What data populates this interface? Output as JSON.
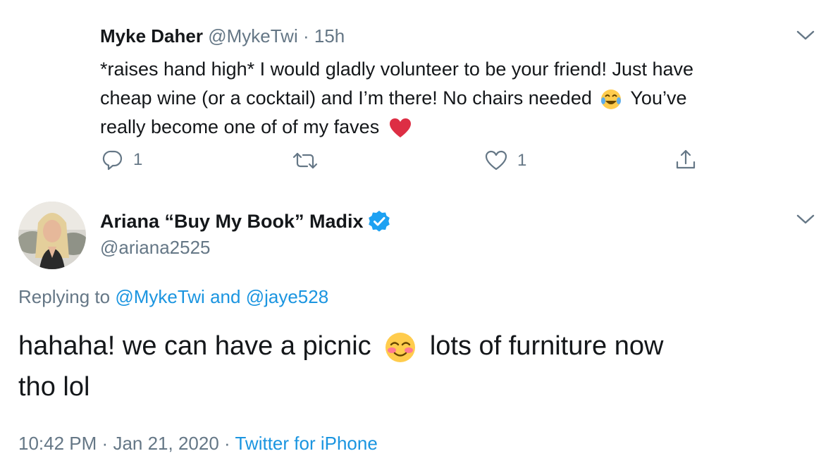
{
  "reply_tweet": {
    "author_name": "Myke Daher",
    "handle": "@MykeTwi",
    "time_sep": "·",
    "time": "15h",
    "text_line1": "*raises hand high* I would gladly volunteer to be your friend! Just have",
    "text_line2a": "cheap wine (or a cocktail) and I’m there! No chairs needed",
    "text_line2b": "You’ve",
    "text_line3": "really become one of of my faves",
    "emoji_laugh": "face-with-tears-of-joy",
    "emoji_heart": "red-heart",
    "reply_count": "1",
    "like_count": "1",
    "icons": [
      "reply-icon",
      "retweet-icon",
      "like-icon",
      "share-icon",
      "chevron-down-icon"
    ]
  },
  "main_tweet": {
    "author_name": "Ariana “Buy My Book” Madix",
    "handle": "@ariana2525",
    "verified_icon": "verified-badge-icon",
    "replying_prefix": "Replying to",
    "replying_user1": "@MykeTwi",
    "replying_and": "and",
    "replying_user2": "@jaye528",
    "text_part1": "hahaha! we can have a picnic",
    "text_part2": "lots of furniture now",
    "text_line2": "tho lol",
    "emoji_smile": "smiling-face-with-blush",
    "time": "10:42 PM",
    "sep1": "·",
    "date": "Jan 21, 2020",
    "sep2": "·",
    "source": "Twitter for iPhone"
  },
  "colors": {
    "text": "#14171a",
    "muted": "#657786",
    "link": "#1b95e0",
    "verified": "#1da1f2",
    "heart": "#e0245e"
  }
}
